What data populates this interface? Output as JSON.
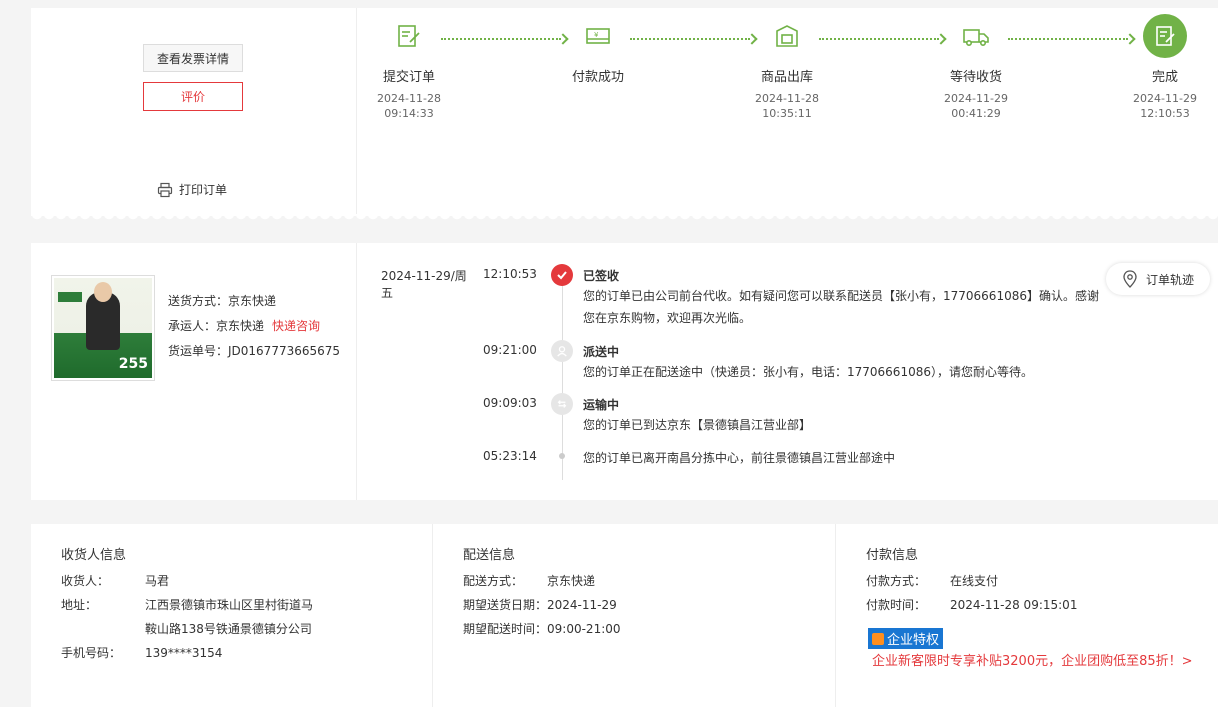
{
  "order_actions": {
    "invoice_label": "查看发票详情",
    "review_label": "评价",
    "print_label": "打印订单"
  },
  "progress": {
    "steps": [
      {
        "name": "提交订单",
        "date": "2024-11-28",
        "time": "09:14:33",
        "icon": "order-submit-icon"
      },
      {
        "name": "付款成功",
        "date": "",
        "time": "",
        "icon": "payment-icon"
      },
      {
        "name": "商品出库",
        "date": "2024-11-28",
        "time": "10:35:11",
        "icon": "warehouse-out-icon"
      },
      {
        "name": "等待收货",
        "date": "2024-11-29",
        "time": "00:41:29",
        "icon": "truck-icon"
      },
      {
        "name": "完成",
        "date": "2024-11-29",
        "time": "12:10:53",
        "icon": "complete-icon"
      }
    ],
    "accent_color": "#71b247"
  },
  "shipping": {
    "method_label": "送货方式：京东快递",
    "carrier_label": "承运人：京东快递",
    "consult_label": "快递咨询",
    "tracking_label": "货运单号：JD0167773665675",
    "product_image_price": "255",
    "track_button_label": "订单轨迹"
  },
  "tracking": [
    {
      "date": "2024-11-29/周五",
      "time": "12:10:53",
      "title": "已签收",
      "desc": "您的订单已由公司前台代收。如有疑问您可以联系配送员【张小有，17706661086】确认。感谢您在京东购物，欢迎再次光临。",
      "icon": "check-icon"
    },
    {
      "date": "",
      "time": "09:21:00",
      "title": "派送中",
      "desc": "您的订单正在配送途中（快递员：张小有，电话：17706661086），请您耐心等待。",
      "icon": "delivery-icon"
    },
    {
      "date": "",
      "time": "09:09:03",
      "title": "运输中",
      "desc": "您的订单已到达京东【景德镇昌江营业部】",
      "icon": "transport-icon"
    },
    {
      "date": "",
      "time": "05:23:14",
      "title": "",
      "desc": "您的订单已离开南昌分拣中心，前往景德镇昌江营业部途中",
      "icon": "dot-icon"
    }
  ],
  "consignee": {
    "heading": "收货人信息",
    "name_key": "收货人：",
    "name_val": "马君",
    "address_key": "地址：",
    "address_line1": "江西景德镇市珠山区里村街道马",
    "address_line2": "鞍山路138号铁通景德镇分公司",
    "phone_key": "手机号码：",
    "phone_val": "139****3154"
  },
  "delivery": {
    "heading": "配送信息",
    "method_key": "配送方式：",
    "method_val": "京东快递",
    "date_key": "期望送货日期：",
    "date_val": "2024-11-29",
    "time_key": "期望配送时间：",
    "time_val": "09:00-21:00"
  },
  "payment": {
    "heading": "付款信息",
    "method_key": "付款方式：",
    "method_val": "在线支付",
    "time_key": "付款时间：",
    "time_val": "2024-11-28 09:15:01",
    "badge_label": "企业特权",
    "promo_text": "企业新客限时专享补贴3200元，企业团购低至85折！>"
  }
}
